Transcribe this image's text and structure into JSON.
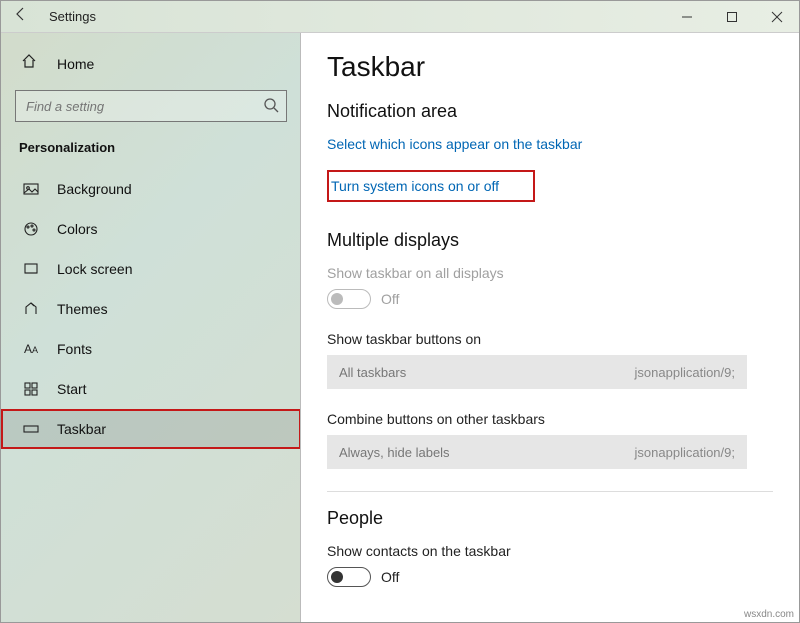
{
  "window": {
    "title": "Settings"
  },
  "sidebar": {
    "home": "Home",
    "search_placeholder": "Find a setting",
    "category": "Personalization",
    "items": [
      {
        "label": "Background",
        "icon": "picture-icon"
      },
      {
        "label": "Colors",
        "icon": "palette-icon"
      },
      {
        "label": "Lock screen",
        "icon": "lockscreen-icon"
      },
      {
        "label": "Themes",
        "icon": "themes-icon"
      },
      {
        "label": "Fonts",
        "icon": "fonts-icon"
      },
      {
        "label": "Start",
        "icon": "start-icon"
      },
      {
        "label": "Taskbar",
        "icon": "taskbar-icon"
      }
    ]
  },
  "main": {
    "title": "Taskbar",
    "section_notification": "Notification area",
    "link_select_icons": "Select which icons appear on the taskbar",
    "link_system_icons": "Turn system icons on or off",
    "section_multiple": "Multiple displays",
    "show_all_displays_label": "Show taskbar on all displays",
    "show_all_displays_state": "Off",
    "show_buttons_label": "Show taskbar buttons on",
    "show_buttons_value": "All taskbars",
    "combine_label": "Combine buttons on other taskbars",
    "combine_value": "Always, hide labels",
    "section_people": "People",
    "show_contacts_label": "Show contacts on the taskbar",
    "show_contacts_state": "Off"
  },
  "watermark": "wsxdn.com"
}
